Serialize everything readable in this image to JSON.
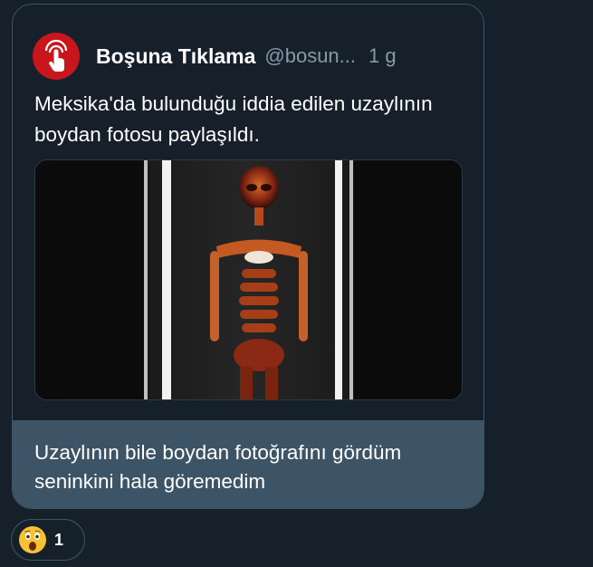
{
  "tweet": {
    "author_name": "Boşuna Tıklama",
    "author_handle": "@bosun...",
    "time": "1 g",
    "avatar_icon": "hand-pointer-icon",
    "text": "Meksika'da bulunduğu iddia edilen uzaylının boydan fotosu paylaşıldı.",
    "media": "x-ray-scan-image"
  },
  "reply": {
    "text": "Uzaylının bile boydan fotoğrafını gördüm seninkini hala göremedim"
  },
  "reaction": {
    "emoji": "surprised-face-emoji",
    "count": "1"
  },
  "colors": {
    "background": "#15202b",
    "border": "#3d5466",
    "reply_bg": "#3d5466",
    "avatar": "#c8161d",
    "secondary_text": "#8899a6"
  }
}
